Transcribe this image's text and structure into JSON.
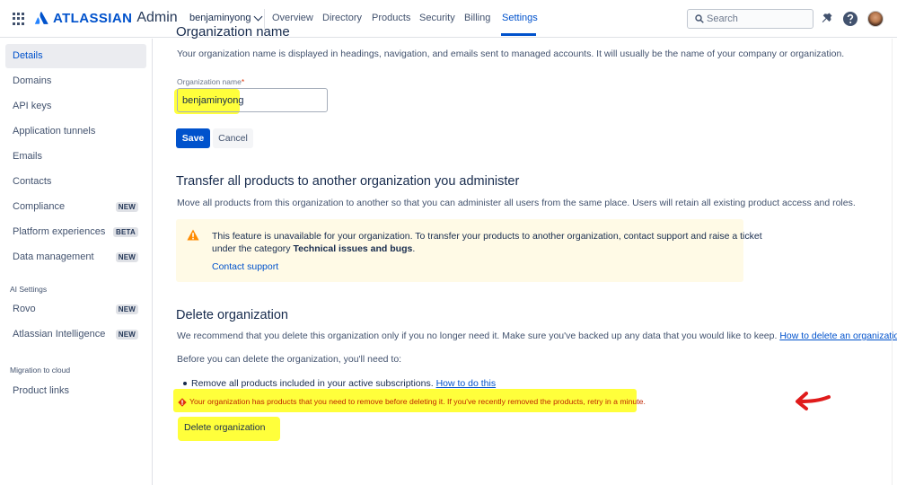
{
  "header": {
    "brand": "ATLASSIAN",
    "product": "Admin",
    "org_switcher": "benjaminyong",
    "tabs": [
      "Overview",
      "Directory",
      "Products",
      "Security",
      "Billing",
      "Settings"
    ],
    "active_tab": "Settings",
    "search_placeholder": "Search",
    "icons": [
      "app-switcher-icon",
      "notifications-icon",
      "help-icon",
      "avatar"
    ]
  },
  "sidebar": {
    "items": [
      {
        "label": "Details",
        "active": true
      },
      {
        "label": "Domains"
      },
      {
        "label": "API keys"
      },
      {
        "label": "Application tunnels"
      },
      {
        "label": "Emails"
      },
      {
        "label": "Contacts"
      },
      {
        "label": "Compliance",
        "badge": "NEW"
      },
      {
        "label": "Platform experiences",
        "badge": "BETA"
      },
      {
        "label": "Data management",
        "badge": "NEW"
      }
    ],
    "ai_heading": "AI Settings",
    "ai_items": [
      {
        "label": "Rovo",
        "badge": "NEW"
      },
      {
        "label": "Atlassian Intelligence",
        "badge": "NEW"
      }
    ],
    "migration_heading": "Migration to cloud",
    "migration_items": [
      {
        "label": "Product links"
      }
    ]
  },
  "main": {
    "org_name_description": "Your organization name is displayed in headings, navigation, and emails sent to managed accounts. It will usually be the name of your company or organization.",
    "org_name_label": "Organization name",
    "required_mark": "*",
    "org_name_value": "benjaminyong",
    "save_label": "Save",
    "cancel_label": "Cancel",
    "transfer": {
      "title": "Transfer all products to another organization you administer",
      "description": "Move all products from this organization to another so that you can administer all users from the same place. Users will retain all existing product access and roles.",
      "warning_line1": "This feature is unavailable for your organization. To transfer your products to another organization, contact support and raise a ticket",
      "warning_line2_prefix": "under the category ",
      "warning_line2_bold": "Technical issues and bugs",
      "warning_line2_suffix": ".",
      "contact_link": "Contact support"
    },
    "delete": {
      "title": "Delete organization",
      "description_prefix": "We recommend that you delete this organization only if you no longer need it. Make sure you've backed up any data that you would like to keep. ",
      "description_link": "How to delete an organization",
      "prereq_intro": "Before you can delete the organization, you'll need to:",
      "bullet_text": "Remove all products included in your active subscriptions. ",
      "bullet_link": "How to do this",
      "error": "Your organization has products that you need to remove before deleting it. If you've recently removed the products, retry in a minute.",
      "button_label": "Delete organization"
    }
  },
  "colors": {
    "brand_blue": "#0052cc",
    "highlight_yellow": "#ffff3b",
    "warning_bg": "#fffae6",
    "error_red": "#bf2600",
    "annotation_arrow": "#e01b1b"
  }
}
